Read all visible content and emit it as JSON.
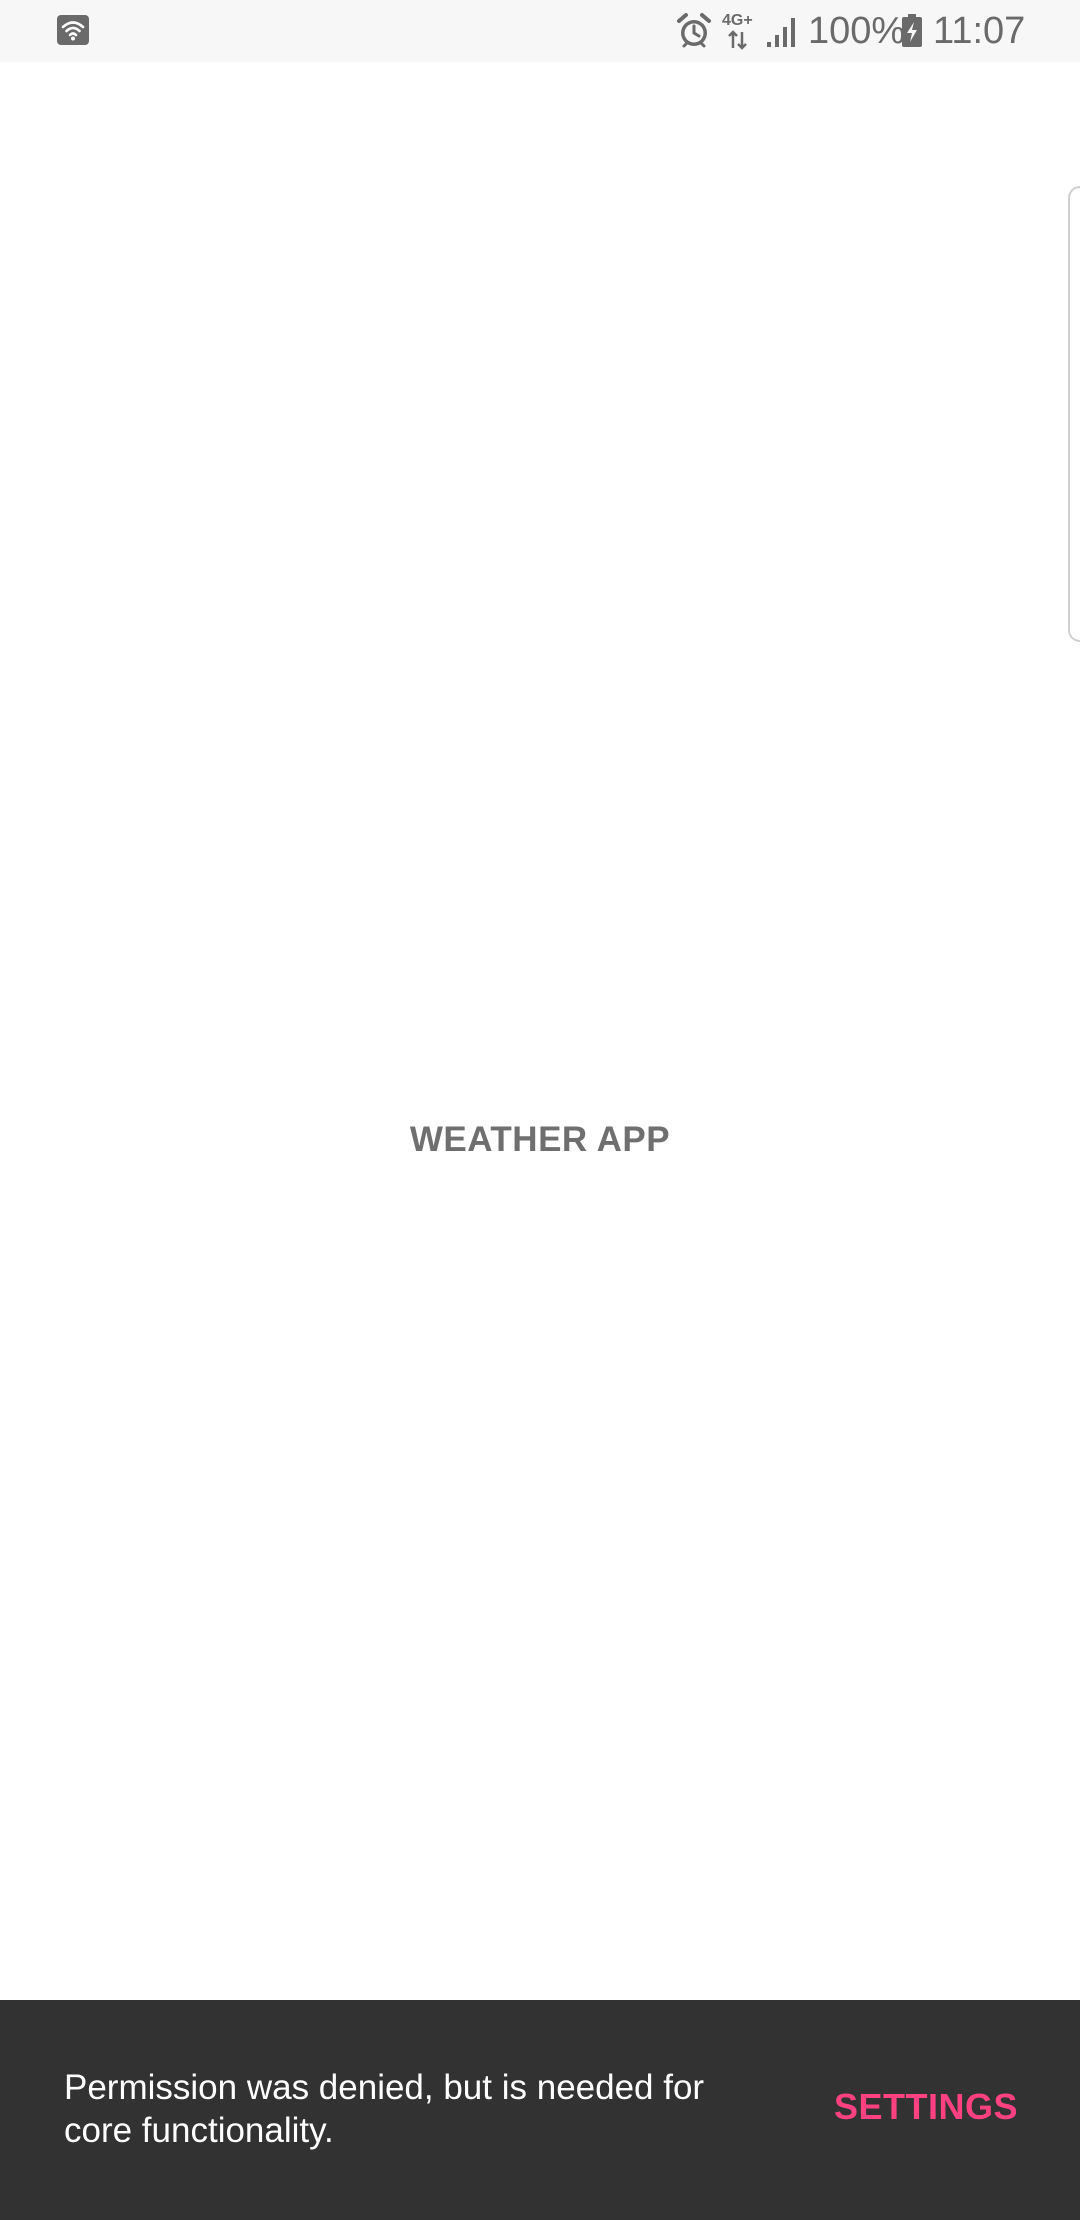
{
  "status_bar": {
    "left_icon": "wifi-notification-icon",
    "icons": [
      "alarm-icon",
      "network-4g-plus-icon",
      "signal-icon",
      "battery-charging-icon"
    ],
    "network_label": "4G+",
    "battery_percent": "100%",
    "time": "11:07",
    "text_color": "#6a6a6a"
  },
  "main": {
    "title": "WEATHER APP",
    "title_color": "#6f6f6f"
  },
  "snackbar": {
    "message": "Permission was denied, but is needed for core functionality.",
    "action_label": "SETTINGS",
    "background": "#323232",
    "action_color": "#ff4081"
  }
}
